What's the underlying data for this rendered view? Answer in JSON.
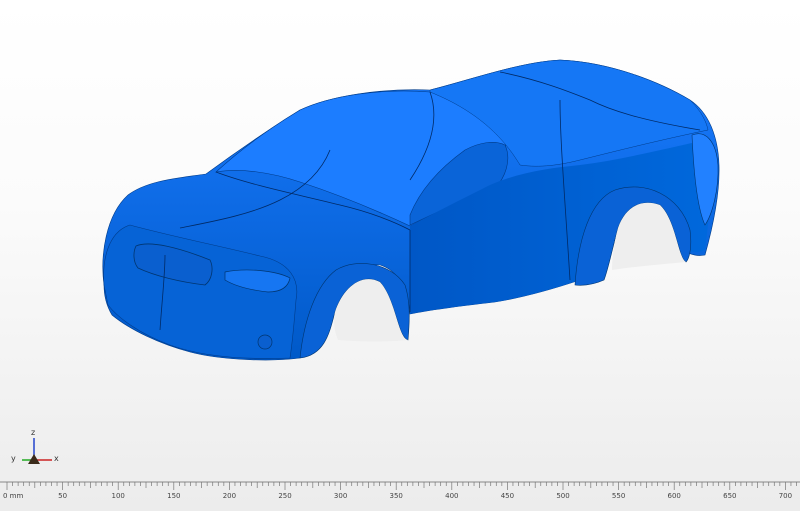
{
  "viewport": {
    "background_top": "#ffffff",
    "background_bottom": "#ececec",
    "model": {
      "name": "car body",
      "color": "#0066dd",
      "shade_color": "#0044aa",
      "highlight_color": "#2f86ff"
    }
  },
  "axis_triad": {
    "x_label": "x",
    "y_label": "y",
    "z_label": "z",
    "colors": {
      "x": "#cc2222",
      "y": "#22aa22",
      "z": "#2244cc"
    }
  },
  "ruler": {
    "unit": "mm",
    "ticks": [
      {
        "label": "0 mm"
      },
      {
        "label": "50"
      },
      {
        "label": "100"
      },
      {
        "label": "150"
      },
      {
        "label": "200"
      },
      {
        "label": "250"
      },
      {
        "label": "300"
      },
      {
        "label": "350"
      },
      {
        "label": "400"
      },
      {
        "label": "450"
      },
      {
        "label": "500"
      },
      {
        "label": "550"
      },
      {
        "label": "600"
      },
      {
        "label": "650"
      },
      {
        "label": "700"
      }
    ]
  }
}
